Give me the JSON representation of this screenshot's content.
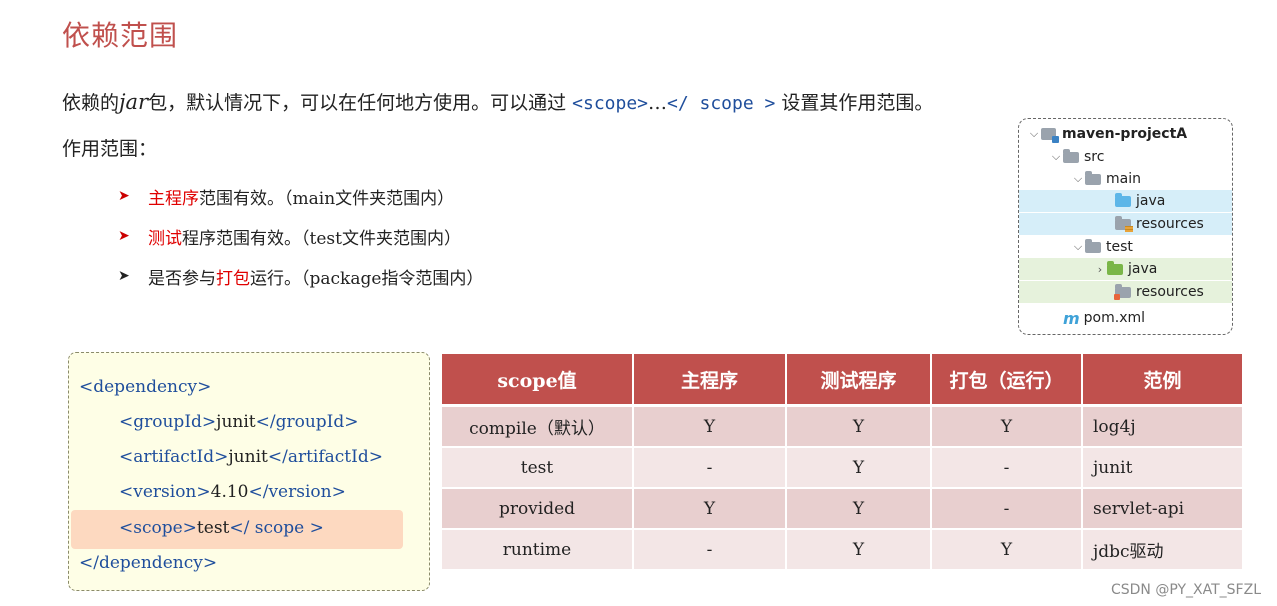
{
  "title": "依赖范围",
  "intro": {
    "before": "依赖的",
    "jar": "jar",
    "middle": "包，默认情况下，可以在任何地方使用。可以通过 ",
    "code_open": "<scope>",
    "ellipsis": "…",
    "code_close": "</ scope >",
    "after": " 设置其作用范围。"
  },
  "scope_label": "作用范围：",
  "bullets": [
    {
      "highlight": "主程序",
      "rest": "范围有效。（main文件夹范围内）"
    },
    {
      "highlight": "测试",
      "rest": "程序范围有效。（test文件夹范围内）"
    },
    {
      "prefix": "是否参与",
      "highlight": "打包",
      "rest": "运行。（package指令范围内）"
    }
  ],
  "tree": {
    "project": "maven-projectA",
    "src": "src",
    "main": "main",
    "java_main": "java",
    "resources_main": "resources",
    "test": "test",
    "java_test": "java",
    "resources_test": "resources",
    "pom": "pom.xml",
    "maven_glyph": "m"
  },
  "xml": {
    "dep_open": "<dependency>",
    "g_open": "<groupId>",
    "g_val": "junit",
    "g_close": "</groupId>",
    "a_open": "<artifactId>",
    "a_val": "junit",
    "a_close": "</artifactId>",
    "v_open": "<version>",
    "v_val": "4.10",
    "v_close": "</version>",
    "s_open": "<scope>",
    "s_val": "test",
    "s_close": "</ scope >",
    "dep_close": "</dependency>"
  },
  "table": {
    "headers": [
      "scope值",
      "主程序",
      "测试程序",
      "打包（运行）",
      "范例"
    ],
    "rows": [
      [
        "compile（默认）",
        "Y",
        "Y",
        "Y",
        "log4j"
      ],
      [
        "test",
        "-",
        "Y",
        "-",
        "junit"
      ],
      [
        "provided",
        "Y",
        "Y",
        "-",
        "servlet-api"
      ],
      [
        "runtime",
        "-",
        "Y",
        "Y",
        "jdbc驱动"
      ]
    ]
  },
  "watermark": "CSDN @PY_XAT_SFZL"
}
